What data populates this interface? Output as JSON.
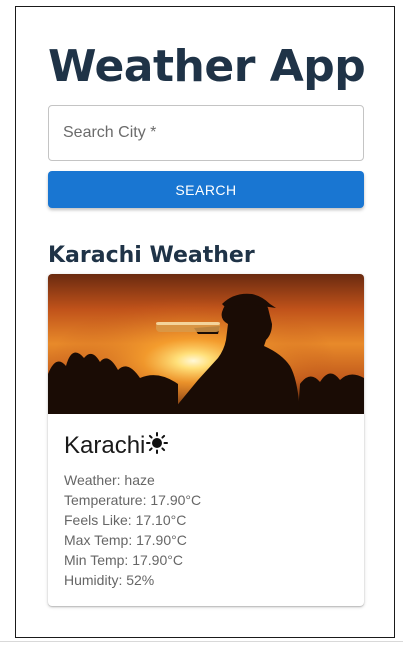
{
  "app": {
    "title": "Weather App"
  },
  "search": {
    "placeholder": "Search City *",
    "value": "",
    "button_label": "SEARCH"
  },
  "result": {
    "heading": "Karachi Weather",
    "city": "Karachi",
    "condition_icon": "sun-icon",
    "details": [
      {
        "label": "Weather",
        "value": "haze",
        "text": "Weather: haze"
      },
      {
        "label": "Temperature",
        "value": "17.90°C",
        "text": "Temperature: 17.90°C"
      },
      {
        "label": "Feels Like",
        "value": "17.10°C",
        "text": "Feels Like: 17.10°C"
      },
      {
        "label": "Max Temp",
        "value": "17.90°C",
        "text": "Max Temp: 17.90°C"
      },
      {
        "label": "Min Temp",
        "value": "17.90°C",
        "text": "Min Temp: 17.90°C"
      },
      {
        "label": "Humidity",
        "value": "52%",
        "text": "Humidity: 52%"
      }
    ]
  },
  "colors": {
    "primary": "#1976d2",
    "title": "#1f3347",
    "text_secondary": "#666666"
  }
}
